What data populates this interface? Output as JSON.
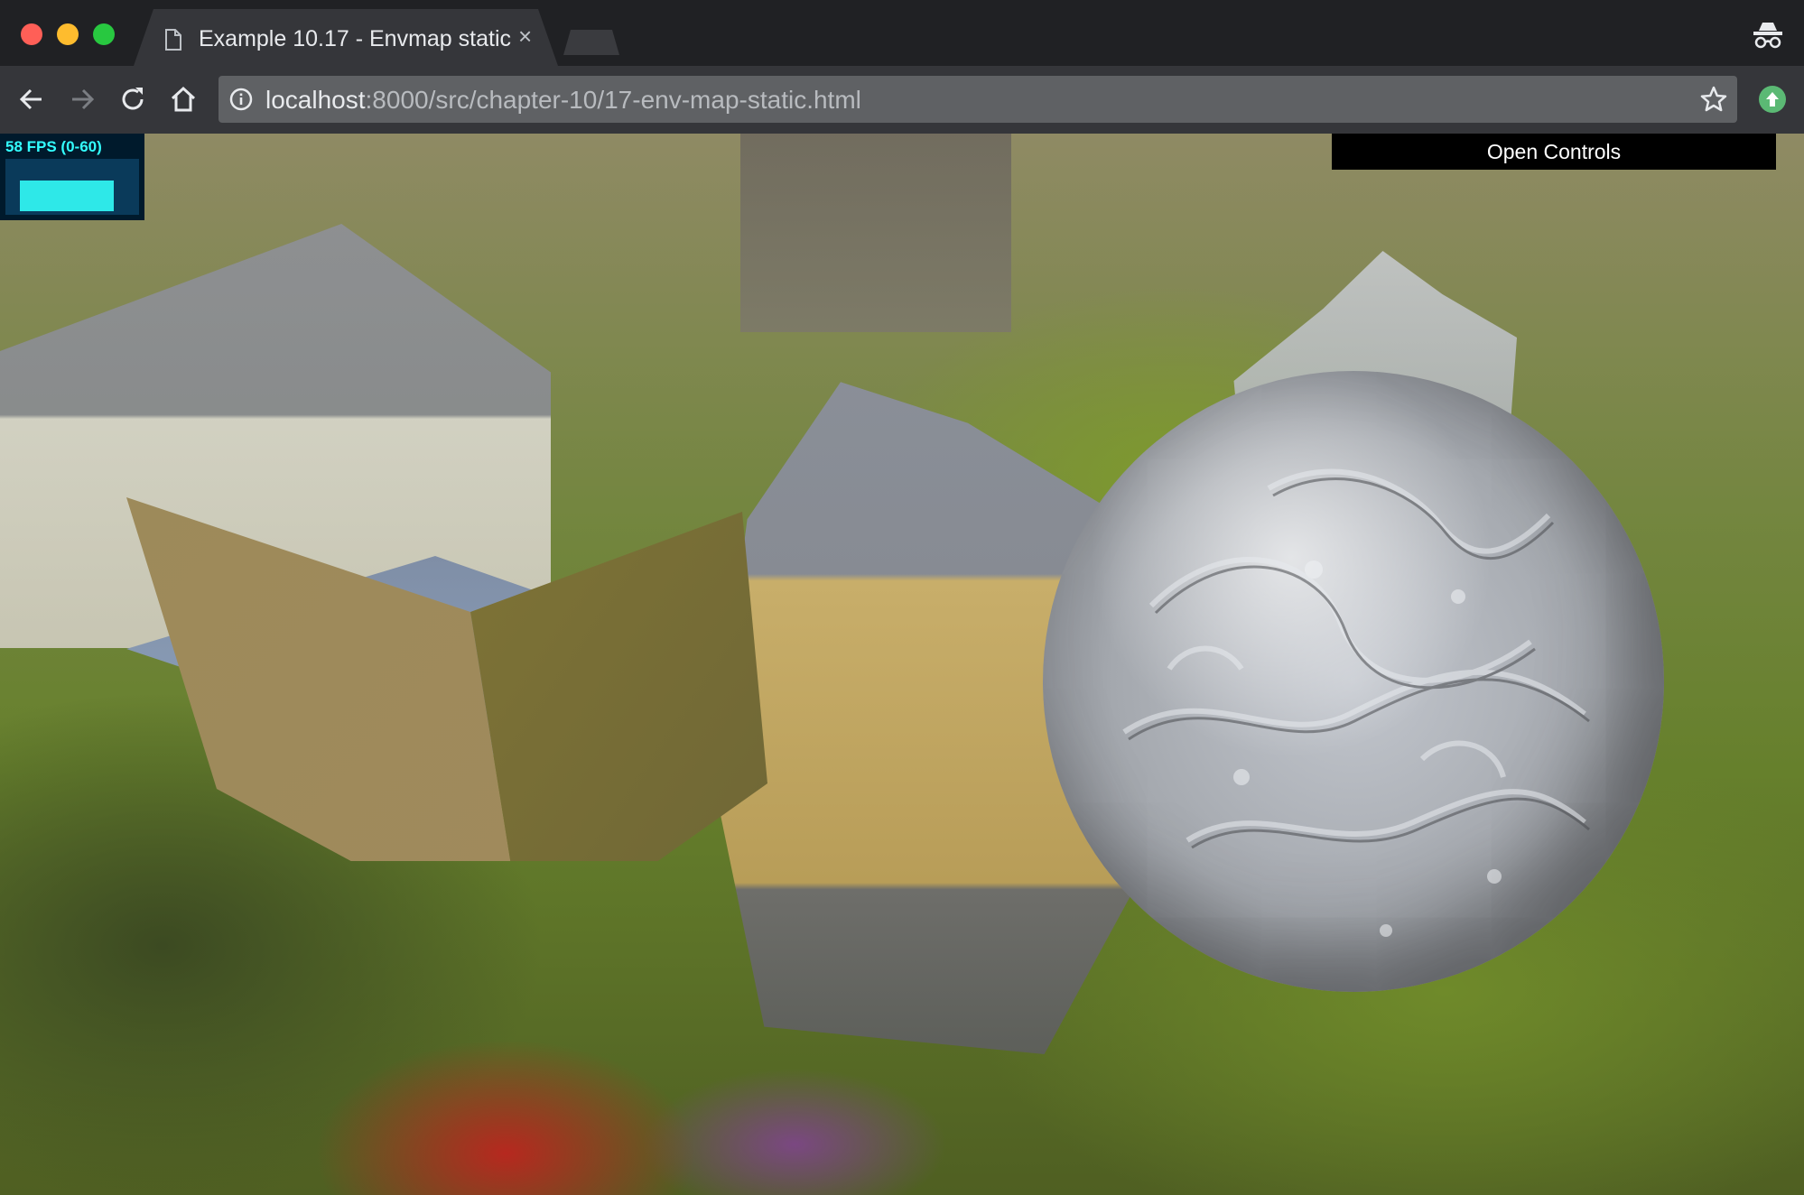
{
  "window": {
    "controls": [
      "close",
      "minimize",
      "maximize"
    ],
    "colors": {
      "close": "#ff5f57",
      "minimize": "#febc2e",
      "maximize": "#28c840"
    }
  },
  "tab": {
    "title": "Example 10.17 - Envmap static",
    "icon": "document-icon",
    "close_glyph": "×"
  },
  "toolbar": {
    "back_icon": "arrow-left-icon",
    "forward_icon": "arrow-right-icon",
    "reload_icon": "reload-icon",
    "home_icon": "home-icon",
    "url_host": "localhost",
    "url_rest": ":8000/src/chapter-10/17-env-map-static.html",
    "bookmark_icon": "star-icon",
    "extension_icon": "upload-icon",
    "profile_icon": "incognito-icon"
  },
  "scene": {
    "stats": {
      "label": "58 FPS (0-60)"
    },
    "controls": {
      "label": "Open Controls"
    },
    "objects": [
      "cube",
      "sphere"
    ]
  }
}
